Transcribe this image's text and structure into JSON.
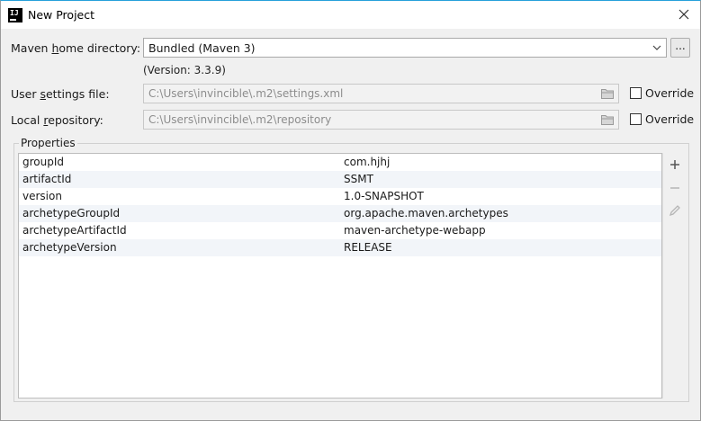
{
  "window": {
    "title": "New Project"
  },
  "maven_home": {
    "label_pre": "Maven ",
    "label_mnemonic": "h",
    "label_post": "ome directory:",
    "value": "Bundled (Maven 3)",
    "browse_label": "...",
    "version_note": "(Version: 3.3.9)"
  },
  "user_settings": {
    "label_pre": "User ",
    "label_mnemonic": "s",
    "label_post": "ettings file:",
    "value": "C:\\Users\\invincible\\.m2\\settings.xml",
    "override_label": "Override",
    "override_checked": false
  },
  "local_repo": {
    "label_pre": "Local ",
    "label_mnemonic": "r",
    "label_post": "epository:",
    "value": "C:\\Users\\invincible\\.m2\\repository",
    "override_label": "Override",
    "override_checked": false
  },
  "properties": {
    "title": "Properties",
    "rows": [
      {
        "key": "groupId",
        "value": "com.hjhj"
      },
      {
        "key": "artifactId",
        "value": "SSMT"
      },
      {
        "key": "version",
        "value": "1.0-SNAPSHOT"
      },
      {
        "key": "archetypeGroupId",
        "value": "org.apache.maven.archetypes"
      },
      {
        "key": "archetypeArtifactId",
        "value": "maven-archetype-webapp"
      },
      {
        "key": "archetypeVersion",
        "value": "RELEASE"
      }
    ],
    "tools": [
      {
        "icon": "plus-icon",
        "enabled": true
      },
      {
        "icon": "minus-icon",
        "enabled": false
      },
      {
        "icon": "pencil-icon",
        "enabled": false
      }
    ]
  }
}
